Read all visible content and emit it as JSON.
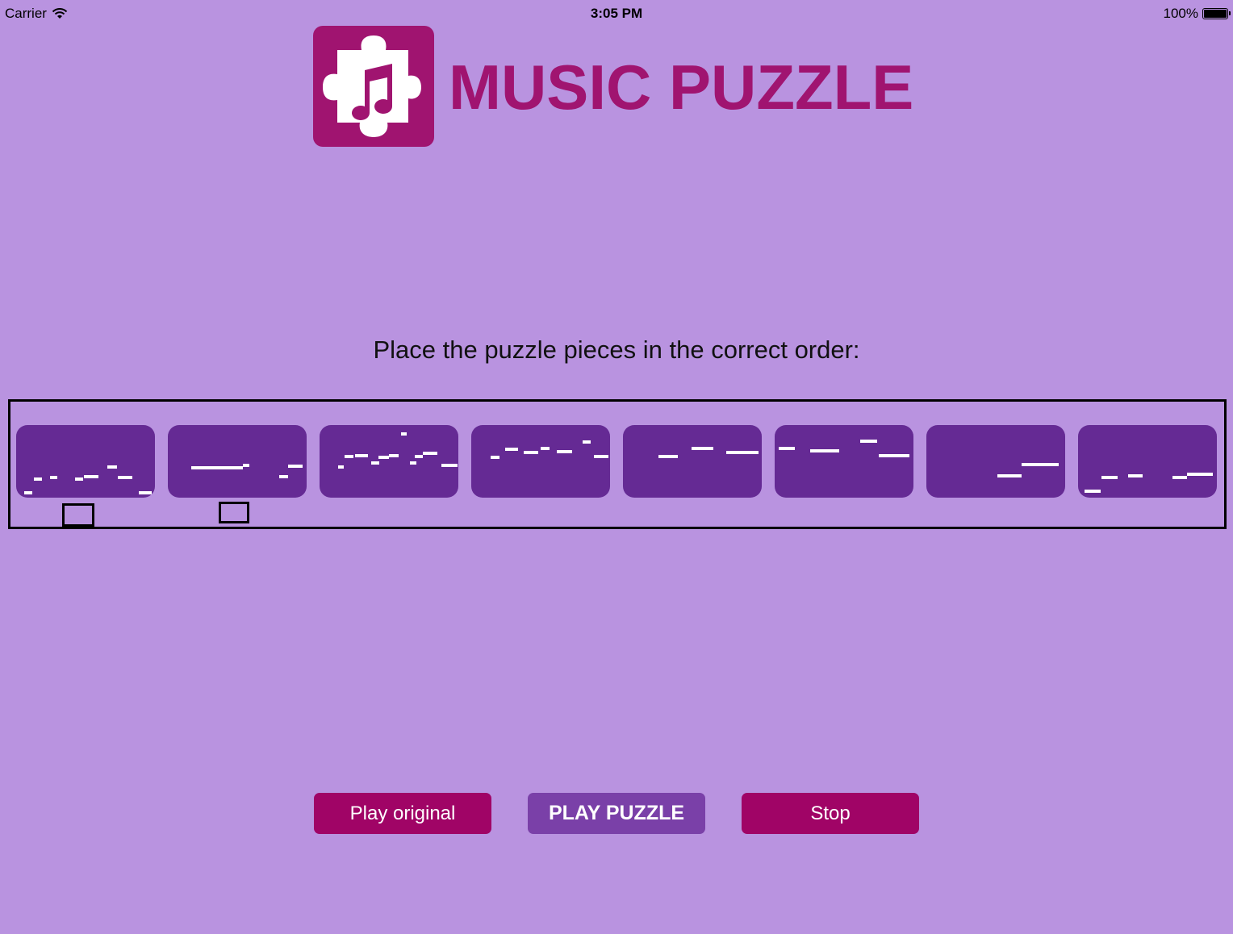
{
  "status_bar": {
    "carrier": "Carrier",
    "time": "3:05 PM",
    "battery": "100%"
  },
  "header": {
    "title": "MUSIC PUZZLE",
    "logo_icon": "puzzle-music-note-icon"
  },
  "instruction": "Place the puzzle pieces in the correct order:",
  "puzzle": {
    "piece_count": 8,
    "selected_markers": 2
  },
  "buttons": {
    "play_original": "Play original",
    "play_puzzle": "PLAY PUZZLE",
    "stop": "Stop"
  },
  "colors": {
    "background": "#b993e0",
    "brand": "#a01470",
    "piece": "#652a94",
    "play_puzzle_button": "#7a40a8",
    "action_button": "#a00466"
  }
}
